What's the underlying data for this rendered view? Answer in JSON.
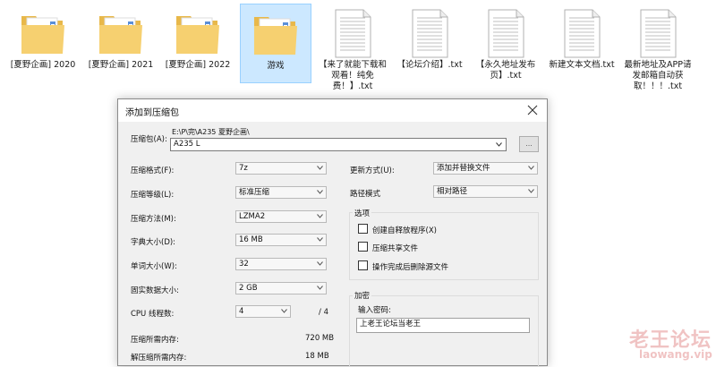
{
  "explorer": {
    "items": [
      {
        "label": "[夏野企画] 2020",
        "icon": "folder-icon"
      },
      {
        "label": "[夏野企画] 2021",
        "icon": "folder-icon"
      },
      {
        "label": "[夏野企画] 2022",
        "icon": "folder-icon"
      },
      {
        "label": "游戏",
        "icon": "folder-icon",
        "selected": true
      },
      {
        "label": "【来了就能下载和观看！纯免费！】.txt",
        "icon": "text-file-icon"
      },
      {
        "label": "【论坛介绍】.txt",
        "icon": "text-file-icon"
      },
      {
        "label": "【永久地址发布页】.txt",
        "icon": "text-file-icon"
      },
      {
        "label": "新建文本文档.txt",
        "icon": "text-file-icon"
      },
      {
        "label": "最新地址及APP请发邮箱自动获取！！！.txt",
        "icon": "text-file-icon"
      }
    ]
  },
  "dialog": {
    "title": "添加到压缩包",
    "archive": {
      "label": "压缩包(A):",
      "path": "E:\\P\\完\\A235 夏野企画\\",
      "value": "A235 L",
      "browse_label": "..."
    },
    "left": {
      "format": {
        "label": "压缩格式(F):",
        "value": "7z"
      },
      "level": {
        "label": "压缩等级(L):",
        "value": "标准压缩"
      },
      "method": {
        "label": "压缩方法(M):",
        "value": "LZMA2"
      },
      "dict": {
        "label": "字典大小(D):",
        "value": "16 MB"
      },
      "word": {
        "label": "单词大小(W):",
        "value": "32"
      },
      "solid": {
        "label": "固实数据大小:",
        "value": "2 GB"
      },
      "threads": {
        "label": "CPU 线程数:",
        "value": "4",
        "total": "/ 4"
      },
      "mem_compress": {
        "label": "压缩所需内存:",
        "value": "720 MB"
      },
      "mem_decompress": {
        "label": "解压缩所需内存:",
        "value": "18 MB"
      }
    },
    "right": {
      "update": {
        "label": "更新方式(U):",
        "value": "添加并替换文件"
      },
      "pathmode": {
        "label": "路径模式",
        "value": "相对路径"
      },
      "options": {
        "title": "选项",
        "items": [
          "创建自释放程序(X)",
          "压缩共享文件",
          "操作完成后删除源文件"
        ]
      },
      "encryption": {
        "title": "加密",
        "password_label": "输入密码:",
        "password_value": "上老王论坛当老王"
      }
    }
  },
  "watermark": {
    "cn": "老王论坛",
    "url": "laowang.vip"
  }
}
